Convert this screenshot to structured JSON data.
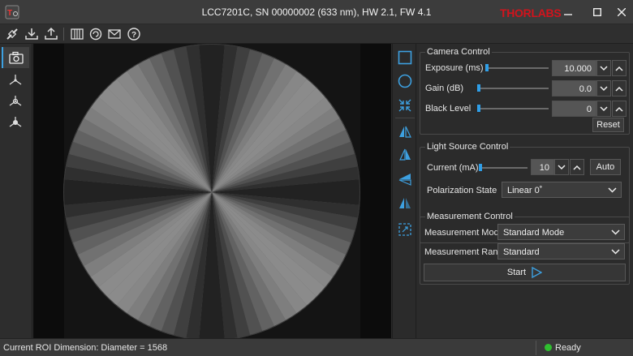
{
  "window": {
    "title": "LCC7201C, SN 00000002 (633 nm), HW 2.1, FW 4.1",
    "brand": "THORLABS",
    "minimize": "–",
    "maximize": "☐",
    "close": "✕"
  },
  "camera_control": {
    "title": "Camera Control",
    "exposure": {
      "label": "Exposure (ms)",
      "value": "10.000"
    },
    "gain": {
      "label": "Gain (dB)",
      "value": "0.0"
    },
    "black_level": {
      "label": "Black Level",
      "value": "0"
    },
    "reset_label": "Reset"
  },
  "light_source_control": {
    "title": "Light Source Control",
    "current": {
      "label": "Current (mA)",
      "value": "10"
    },
    "auto_label": "Auto",
    "polarization": {
      "label": "Polarization State",
      "selected": "Linear 0˚"
    }
  },
  "measurement_control": {
    "title": "Measurement Control",
    "mode": {
      "label": "Measurement Mode",
      "selected": "Standard Mode"
    },
    "range": {
      "label": "Measurement Range",
      "selected": "Standard"
    },
    "start_label": "Start"
  },
  "status": {
    "message": "Current ROI Dimension: Diameter = 1568",
    "state": "Ready"
  },
  "colors": {
    "accent": "#3da0e0",
    "brand": "#d2131c",
    "ready": "#2fbf2f"
  }
}
